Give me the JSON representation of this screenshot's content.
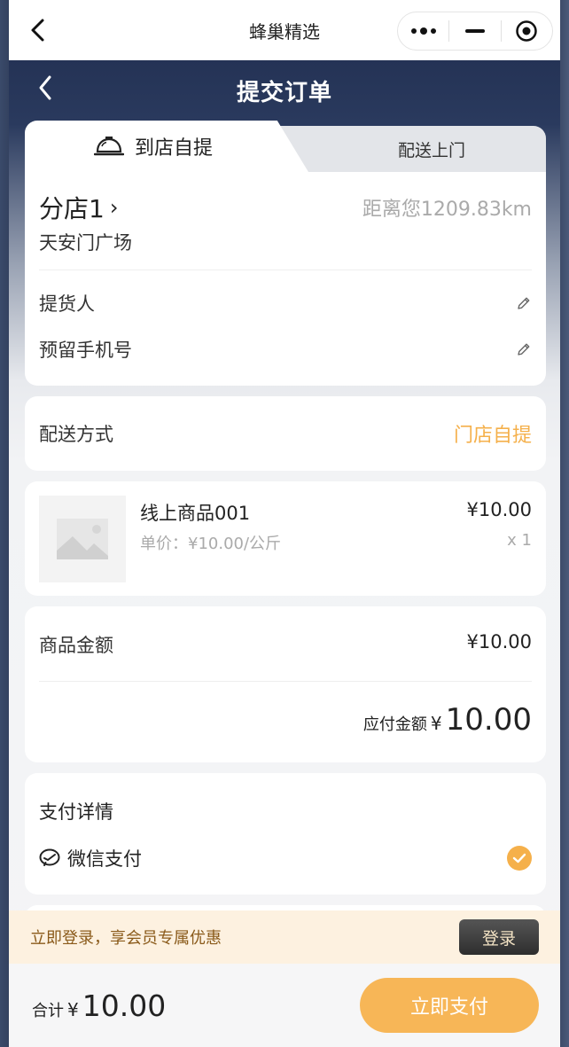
{
  "mini_program": {
    "title": "蜂巢精选"
  },
  "page": {
    "title": "提交订单"
  },
  "tabs": {
    "active": "到店自提",
    "inactive": "配送上门"
  },
  "store": {
    "name": "分店1",
    "chevron": "›",
    "distance": "距离您1209.83km",
    "address": "天安门广场"
  },
  "fields": {
    "picker": "提货人",
    "phone": "预留手机号"
  },
  "delivery": {
    "label": "配送方式",
    "value": "门店自提"
  },
  "goods": {
    "name": "线上商品001",
    "unit_price": "单价：¥10.00/公斤",
    "price": "¥10.00",
    "qty": "x 1"
  },
  "amounts": {
    "goods_label": "商品金额",
    "goods_value": "¥10.00",
    "payable_label": "应付金额",
    "payable_currency": "¥",
    "payable_value": "10.00"
  },
  "payment": {
    "title": "支付详情",
    "method": "微信支付"
  },
  "login_promo": {
    "text": "立即登录，享会员专属优惠",
    "button": "登录"
  },
  "footer": {
    "total_label": "合计",
    "currency": "¥",
    "total_value": "10.00",
    "pay_button": "立即支付"
  },
  "colors": {
    "accent": "#f5b04b",
    "header": "#1f2c4d"
  }
}
